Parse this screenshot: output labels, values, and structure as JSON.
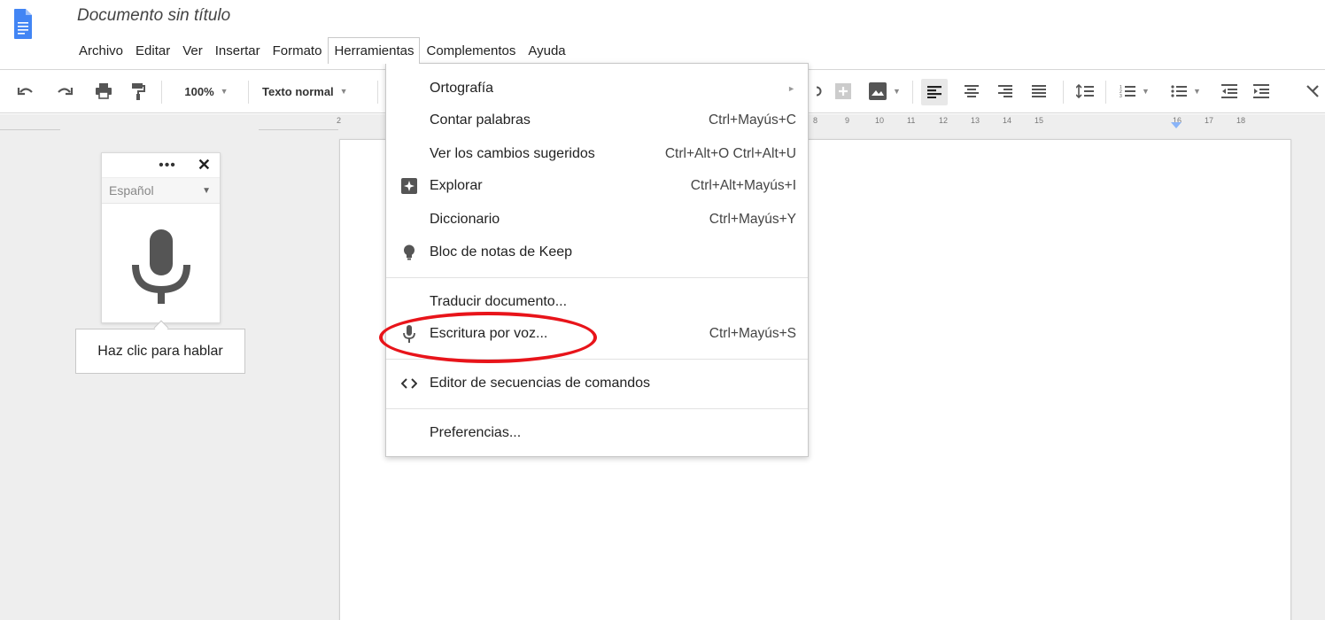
{
  "app": {
    "doc_title": "Documento sin título"
  },
  "menubar": [
    {
      "label": "Archivo"
    },
    {
      "label": "Editar"
    },
    {
      "label": "Ver"
    },
    {
      "label": "Insertar"
    },
    {
      "label": "Formato"
    },
    {
      "label": "Herramientas",
      "active": true
    },
    {
      "label": "Complementos"
    },
    {
      "label": "Ayuda"
    }
  ],
  "toolbar": {
    "zoom": "100%",
    "style": "Texto normal"
  },
  "ruler": {
    "ticks": [
      "2",
      "8",
      "9",
      "10",
      "11",
      "12",
      "13",
      "14",
      "15",
      "16",
      "17",
      "18"
    ]
  },
  "voice_panel": {
    "language": "Español",
    "tooltip": "Haz clic para hablar"
  },
  "tools_menu": {
    "items": [
      {
        "label": "Ortografía",
        "shortcut": "",
        "icon": "",
        "submenu": true
      },
      {
        "label": "Contar palabras",
        "shortcut": "Ctrl+Mayús+C",
        "icon": ""
      },
      {
        "label": "Ver los cambios sugeridos",
        "shortcut": "Ctrl+Alt+O Ctrl+Alt+U",
        "icon": ""
      },
      {
        "label": "Explorar",
        "shortcut": "Ctrl+Alt+Mayús+I",
        "icon": "explore-icon"
      },
      {
        "label": "Diccionario",
        "shortcut": "Ctrl+Mayús+Y",
        "icon": ""
      },
      {
        "label": "Bloc de notas de Keep",
        "shortcut": "",
        "icon": "lightbulb-icon"
      },
      {
        "label": "Traducir documento...",
        "shortcut": "",
        "icon": ""
      },
      {
        "label": "Escritura por voz...",
        "shortcut": "Ctrl+Mayús+S",
        "icon": "microphone-icon",
        "highlighted": true
      },
      {
        "label": "Editor de secuencias de comandos",
        "shortcut": "",
        "icon": "code-icon"
      },
      {
        "label": "Preferencias...",
        "shortcut": "",
        "icon": ""
      }
    ]
  },
  "colors": {
    "highlight": "#e8141a",
    "docs_blue": "#4285f4",
    "ruler_marker": "#8ab4f8"
  }
}
